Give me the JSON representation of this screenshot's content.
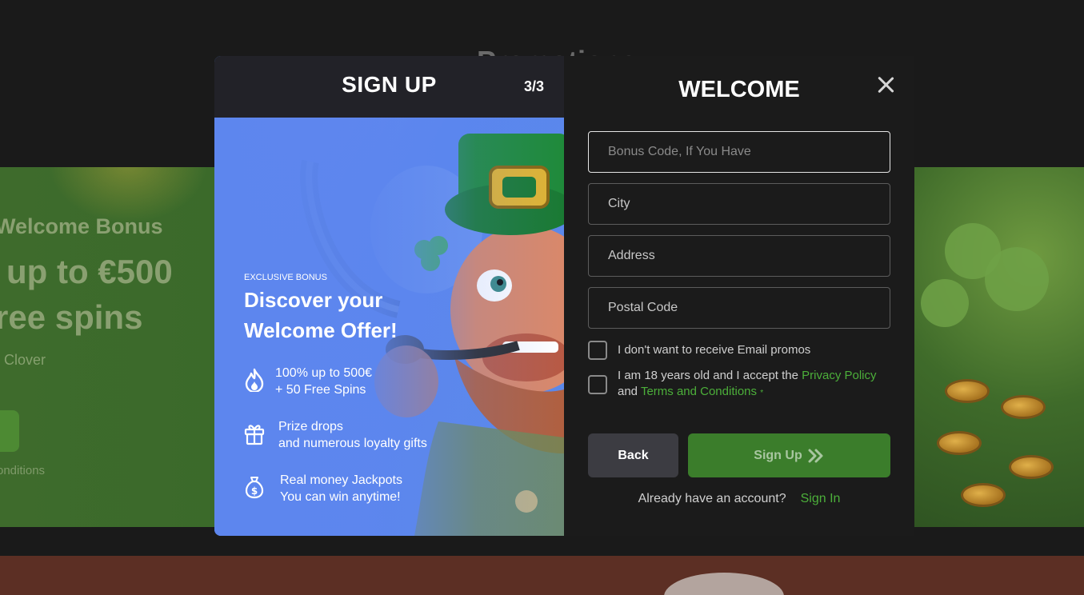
{
  "background": {
    "heading": "Promotions",
    "banner_line1": "Welcome Bonus",
    "banner_line2": "up to €500",
    "banner_line3": "ree spins",
    "banner_line4": "l Clover",
    "banner_line5": "onditions"
  },
  "modal": {
    "left": {
      "title": "SIGN UP",
      "step": "3/3",
      "exclusive_label": "EXCLUSIVE BONUS",
      "headline": "Discover your Welcome Offer!",
      "features": [
        {
          "line1": "100% up to 500€",
          "line2": "+ 50 Free Spins",
          "icon": "flame-icon"
        },
        {
          "line1": "Prize drops",
          "line2": "and numerous loyalty gifts",
          "icon": "gift-icon"
        },
        {
          "line1": "Real money Jackpots",
          "line2": "You can win anytime!",
          "icon": "money-bag-icon"
        }
      ]
    },
    "right": {
      "title": "WELCOME",
      "fields": {
        "bonus_placeholder": "Bonus Code, If You Have",
        "city_placeholder": "City",
        "address_placeholder": "Address",
        "postal_placeholder": "Postal Code"
      },
      "checkbox_email": "I don't want to receive Email promos",
      "checkbox_terms_prefix": "I am 18 years old and I accept the",
      "privacy_link": "Privacy Policy",
      "and_text": "and",
      "terms_link": "Terms and Conditions",
      "required_mark": "*",
      "back_label": "Back",
      "signup_label": "Sign Up",
      "already_text": "Already have an account?",
      "signin_link": "Sign In"
    }
  },
  "colors": {
    "accent_green": "#4caf3a",
    "signup_button": "#3b7d2b",
    "left_panel_blue": "#5a8cf0",
    "modal_dark": "#1b1b1b"
  }
}
